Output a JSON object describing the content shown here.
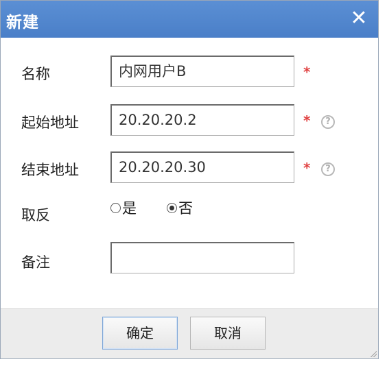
{
  "dialog": {
    "title": "新建",
    "close_glyph": "✕",
    "title_bar_color": "#4f86cf"
  },
  "form": {
    "name": {
      "label": "名称",
      "value": "内网用户B",
      "required_mark": "*"
    },
    "start_address": {
      "label": "起始地址",
      "value": "20.20.20.2",
      "required_mark": "*",
      "help_glyph": "?"
    },
    "end_address": {
      "label": "结束地址",
      "value": "20.20.20.30",
      "required_mark": "*",
      "help_glyph": "?"
    },
    "invert": {
      "label": "取反",
      "options": [
        "是",
        "否"
      ],
      "selected": "否"
    },
    "remark": {
      "label": "备注",
      "value": ""
    }
  },
  "footer": {
    "ok_label": "确定",
    "cancel_label": "取消"
  },
  "colors": {
    "required": "#e04040",
    "footer_bg": "#ececec"
  }
}
